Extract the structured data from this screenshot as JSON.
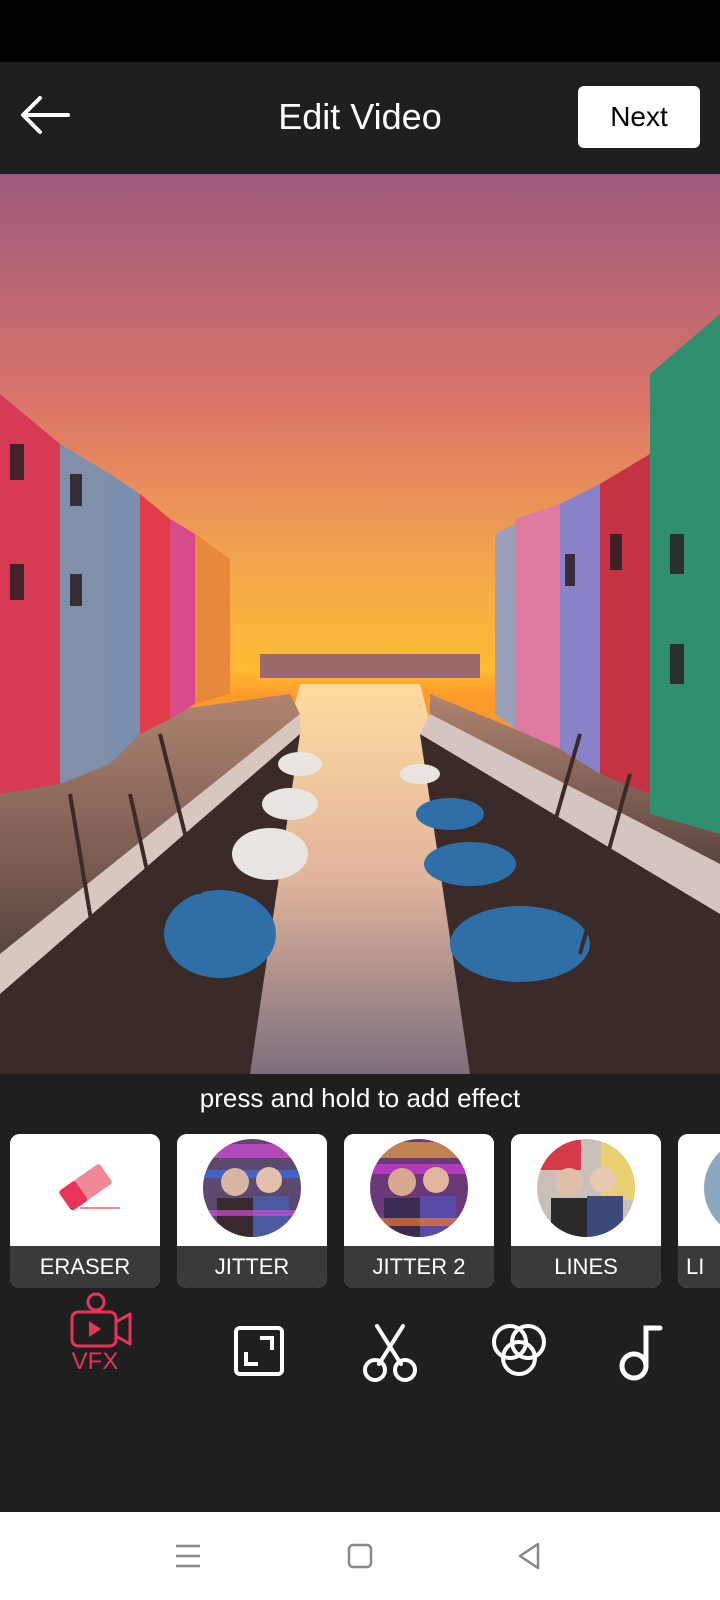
{
  "header": {
    "title": "Edit Video",
    "next_label": "Next"
  },
  "preview": {
    "hint": "press and hold to add effect"
  },
  "effects": [
    {
      "label": "ERASER",
      "icon": "eraser-icon"
    },
    {
      "label": "JITTER",
      "icon": "jitter-thumbnail"
    },
    {
      "label": "JITTER 2",
      "icon": "jitter-2-thumbnail"
    },
    {
      "label": "LINES",
      "icon": "lines-thumbnail"
    },
    {
      "label": "LI",
      "icon": "partial-thumbnail"
    }
  ],
  "toolbar": {
    "vfx_label": "VFX",
    "items": [
      "vfx-icon",
      "crop-icon",
      "scissors-icon",
      "filter-icon",
      "music-note-icon"
    ],
    "active_color": "#e8335a"
  },
  "nav": [
    "menu-icon",
    "home-icon",
    "back-triangle-icon"
  ]
}
